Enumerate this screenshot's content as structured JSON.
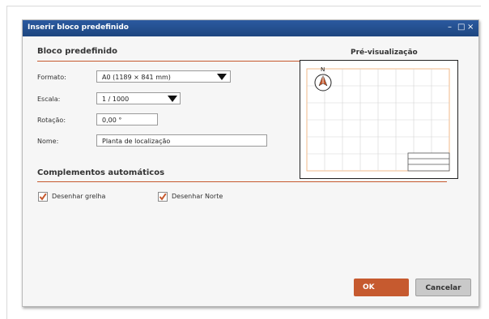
{
  "window": {
    "title": "Inserir bloco predefinido",
    "controls": {
      "minimize": "–",
      "maximize": "□",
      "close": "×"
    }
  },
  "block_section": {
    "title": "Bloco predefinido",
    "fields": {
      "format": {
        "label": "Formato:",
        "value": "A0  (1189 × 841 mm)"
      },
      "scale": {
        "label": "Escala:",
        "value": "1 / 1000"
      },
      "rotation": {
        "label": "Rotação:",
        "value": "0,00 °"
      },
      "name": {
        "label": "Nome:",
        "value": "Planta de localização"
      }
    }
  },
  "preview": {
    "title": "Pré-visualização",
    "north_label": "N",
    "grid": {
      "columns": 8,
      "rows": 6
    },
    "colors": {
      "border": "#f0b98a",
      "grid": "#cfcfcf",
      "north_arrow": "#c65a2f"
    }
  },
  "addons_section": {
    "title": "Complementos automáticos",
    "draw_grid": {
      "label": "Desenhar grelha",
      "checked": true
    },
    "draw_north": {
      "label": "Desenhar Norte",
      "checked": true
    }
  },
  "buttons": {
    "ok": "OK",
    "cancel": "Cancelar"
  },
  "colors": {
    "accent": "#c65a2f",
    "titlebar": "#1f4a86"
  }
}
